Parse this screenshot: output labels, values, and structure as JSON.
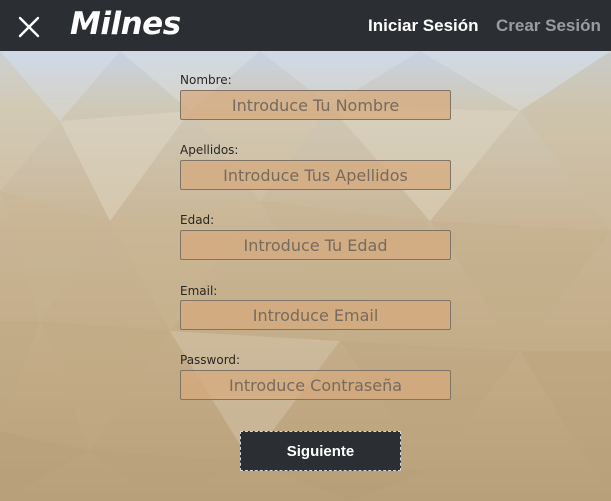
{
  "window": {
    "title": "Milnes",
    "nav": {
      "login_label": "Iniciar Sesión",
      "signup_label": "Crear Sesión"
    }
  },
  "form": {
    "fields": [
      {
        "label": "Nombre:",
        "placeholder": "Introduce Tu Nombre",
        "value": ""
      },
      {
        "label": "Apellidos:",
        "placeholder": "Introduce Tus Apellidos",
        "value": ""
      },
      {
        "label": "Edad:",
        "placeholder": "Introduce Tu Edad",
        "value": ""
      },
      {
        "label": "Email:",
        "placeholder": "Introduce Email",
        "value": ""
      },
      {
        "label": "Password:",
        "placeholder": "Introduce Contraseña",
        "value": ""
      }
    ],
    "submit_label": "Siguiente"
  },
  "icons": {
    "close": "close-icon"
  },
  "colors": {
    "titlebar": "#2b2e32",
    "active_nav": "#ffffff",
    "inactive_nav": "#9a9ca0",
    "input_fill": "#d6aa7d",
    "button": "#2b2e32"
  }
}
